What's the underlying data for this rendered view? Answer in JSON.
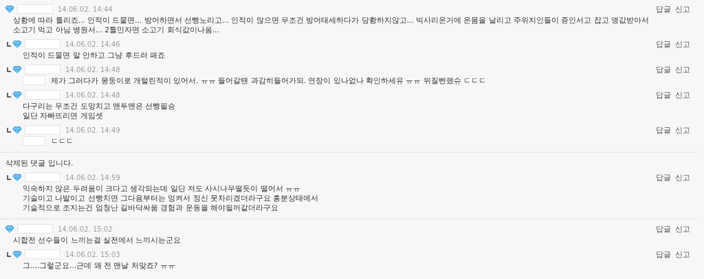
{
  "threads": [
    {
      "comments": [
        {
          "kind": "comment",
          "date": "14.06.02. 14:44",
          "masked_prefix": false,
          "lines": [
            "상황에 따라 틀리죠... 인적이 드물면... 방어하면서 선빵노리고... 인적이 많으면 무조건 방어태세하다가 당황하지않고... 빅사리온거에 온몸을 날리고 주위지인들이 증인서고 잡고 앵값받아서 소고기 먹고 아님 병원서... 2틀만자면 소고기 회식값이나옴..."
          ],
          "actions": [
            "답글",
            "신고"
          ]
        },
        {
          "kind": "reply",
          "date": "14.06.02. 14:46",
          "masked_prefix": false,
          "lines": [
            "인적이 드물면 말 안하고 그냥 후드러 패죠"
          ],
          "actions": [
            "답글",
            "신고"
          ]
        },
        {
          "kind": "reply",
          "date": "14.06.02. 14:48",
          "masked_prefix": true,
          "lines": [
            "제가 그러다가 몽둥이로 개털린적이 있어서. ㅠㅠ 들어갈땐 과감히들어가되. 연장이 있나없나 확인하세유 ㅠㅠ 뒤질빤했슈 ㄷㄷㄷ"
          ],
          "actions": [
            "답글",
            "신고"
          ]
        },
        {
          "kind": "reply",
          "date": "14.06.02. 14:48",
          "masked_prefix": false,
          "lines": [
            "다구리는 무조건 도망치고 맨투맨은 선빵필승",
            "일단 자빠뜨리면 게임셋"
          ],
          "actions": [
            "답글",
            "신고"
          ]
        },
        {
          "kind": "reply",
          "date": "14.06.02. 14:49",
          "masked_prefix": true,
          "lines": [
            "ㄷㄷㄷ"
          ],
          "actions": [
            "답글",
            "신고"
          ]
        }
      ]
    },
    {
      "comments": [
        {
          "kind": "deleted",
          "lines": [
            "삭제된 댓글 입니다."
          ]
        },
        {
          "kind": "reply",
          "date": "14.06.02. 14:59",
          "masked_prefix": false,
          "lines": [
            "익숙하지 않은 두려움이 크다고 생각되는데 일단 저도 사시나무떨듯이 떨어서 ㅠㅠ",
            "기술이고 나발이고 선빵치면 그다음부터는 엉켜서 정신 못차리겠더라구요 흥분상태에서",
            "기술적으로 조지는건 엄청난 길바닥싸움 경험과 운동을 해야될꺼같더라구요"
          ],
          "actions": [
            "답글",
            "신고"
          ]
        }
      ]
    },
    {
      "comments": [
        {
          "kind": "comment",
          "date": "14.06.02. 15:02",
          "masked_prefix": false,
          "lines": [
            "시합전 선수들이 느끼는걸 실전에서 느끼시는군요"
          ],
          "actions": [
            "답글",
            "신고"
          ]
        },
        {
          "kind": "reply",
          "date": "14.06.02. 15:03",
          "masked_prefix": false,
          "lines": [
            "그....그렇군요...근데 왜 전 맨날 처맞죠? ㅠㅠ"
          ],
          "actions": [
            "답글",
            "신고"
          ]
        }
      ]
    }
  ]
}
